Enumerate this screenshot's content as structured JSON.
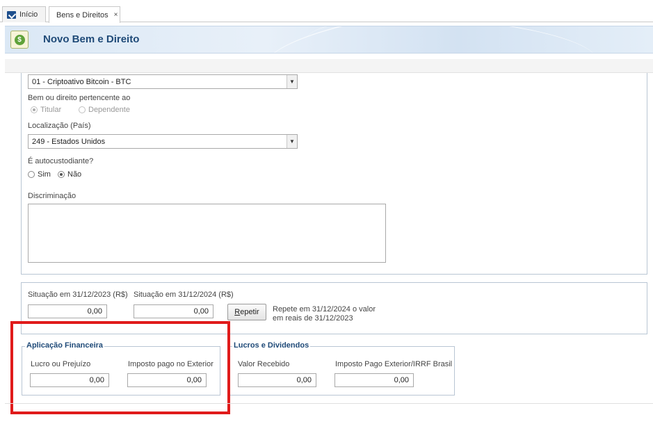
{
  "tabs": [
    {
      "label": "Início"
    },
    {
      "label": "Bens e Direitos",
      "close": "×"
    }
  ],
  "header": {
    "title": "Novo Bem e Direito",
    "icon_glyph": "$"
  },
  "form": {
    "tipo_select": {
      "value": "01 - Criptoativo Bitcoin - BTC"
    },
    "pertencente": {
      "label": "Bem ou direito pertencente ao",
      "options": [
        {
          "label": "Titular",
          "checked": true
        },
        {
          "label": "Dependente",
          "checked": false
        }
      ]
    },
    "localizacao": {
      "label": "Localização (País)",
      "value": "249 - Estados Unidos"
    },
    "autocustodiante": {
      "label": "É autocustodiante?",
      "options": [
        {
          "label": "Sim",
          "checked": false
        },
        {
          "label": "Não",
          "checked": true
        }
      ]
    },
    "discriminacao": {
      "label": "Discriminação",
      "value": ""
    }
  },
  "situacao": {
    "sit_2023": {
      "label": "Situação em 31/12/2023 (R$)",
      "value": "0,00"
    },
    "sit_2024": {
      "label": "Situação em 31/12/2024 (R$)",
      "value": "0,00"
    },
    "repetir_button": {
      "underlined": "R",
      "rest": "epetir"
    },
    "note_line1": "Repete em 31/12/2024 o valor",
    "note_line2": "em reais de 31/12/2023"
  },
  "aplicacao": {
    "legend": "Aplicação Financeira",
    "lucro": {
      "label": "Lucro ou Prejuízo",
      "value": "0,00"
    },
    "imposto": {
      "label": "Imposto pago no Exterior",
      "value": "0,00"
    }
  },
  "lucros_dividendos": {
    "legend": "Lucros e Dividendos",
    "valor": {
      "label": "Valor Recebido",
      "value": "0,00"
    },
    "imposto": {
      "label": "Imposto Pago Exterior/IRRF Brasil",
      "value": "0,00"
    }
  },
  "colors": {
    "accent": "#1f4a78",
    "highlight": "#e01b1b"
  }
}
